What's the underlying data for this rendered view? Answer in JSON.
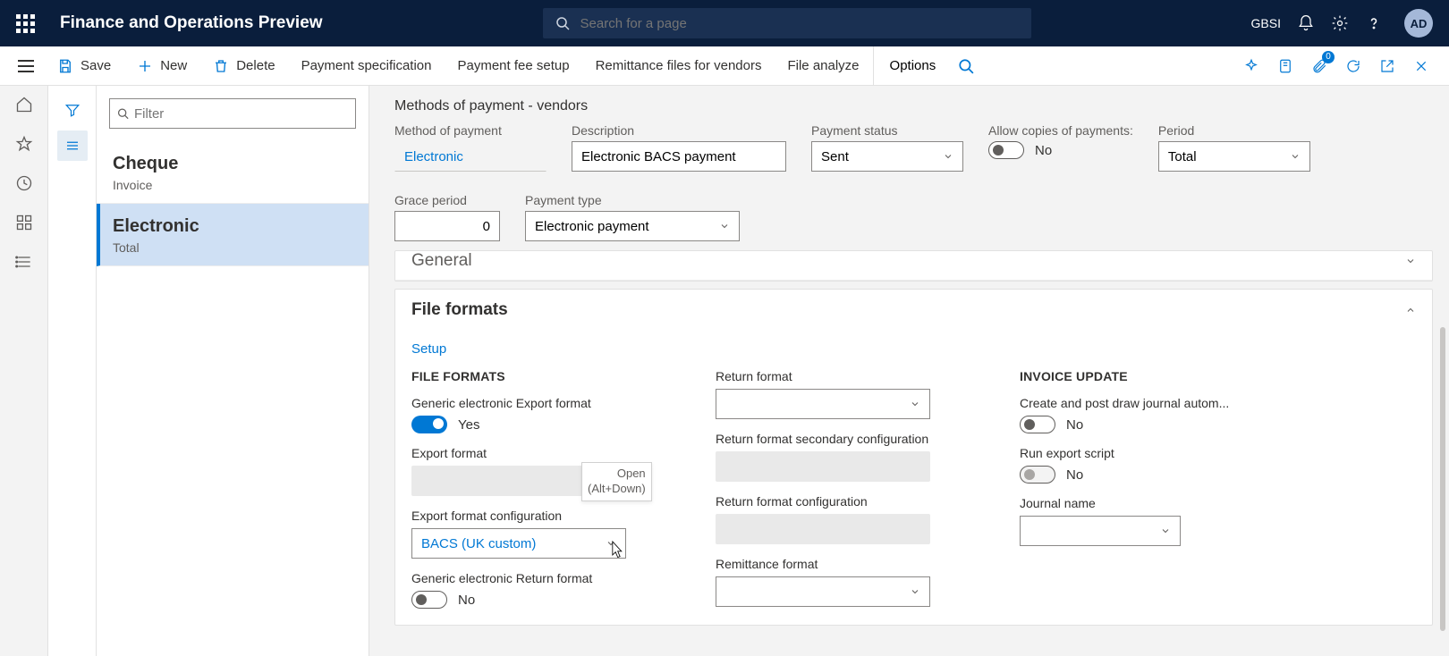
{
  "topbar": {
    "app_title": "Finance and Operations Preview",
    "search_placeholder": "Search for a page",
    "company": "GBSI",
    "avatar": "AD"
  },
  "actionbar": {
    "save": "Save",
    "new": "New",
    "delete": "Delete",
    "payment_spec": "Payment specification",
    "payment_fee": "Payment fee setup",
    "remittance": "Remittance files for vendors",
    "file_analyze": "File analyze",
    "options": "Options",
    "badge_count": "0"
  },
  "filter": {
    "placeholder": "Filter"
  },
  "list": [
    {
      "title": "Cheque",
      "sub": "Invoice"
    },
    {
      "title": "Electronic",
      "sub": "Total"
    }
  ],
  "page_title": "Methods of payment - vendors",
  "header": {
    "method_label": "Method of payment",
    "method_value": "Electronic",
    "desc_label": "Description",
    "desc_value": "Electronic BACS payment",
    "status_label": "Payment status",
    "status_value": "Sent",
    "allow_label": "Allow copies of payments:",
    "allow_text": "No",
    "period_label": "Period",
    "period_value": "Total",
    "grace_label": "Grace period",
    "grace_value": "0",
    "ptype_label": "Payment type",
    "ptype_value": "Electronic payment"
  },
  "sections": {
    "general": "General",
    "file_formats": "File formats",
    "setup": "Setup"
  },
  "fileformats": {
    "heading": "FILE FORMATS",
    "gen_export_label": "Generic electronic Export format",
    "gen_export_text": "Yes",
    "export_format_label": "Export format",
    "export_config_label": "Export format configuration",
    "export_config_value": "BACS (UK custom)",
    "gen_return_label": "Generic electronic Return format",
    "gen_return_text": "No",
    "return_format_label": "Return format",
    "return_sec_label": "Return format secondary configuration",
    "return_cfg_label": "Return format configuration",
    "remit_label": "Remittance format",
    "invoice_heading": "INVOICE UPDATE",
    "create_post_label": "Create and post draw journal autom...",
    "create_post_text": "No",
    "run_script_label": "Run export script",
    "run_script_text": "No",
    "journal_label": "Journal name"
  },
  "tooltip": {
    "line1": "Open",
    "line2": "(Alt+Down)"
  }
}
